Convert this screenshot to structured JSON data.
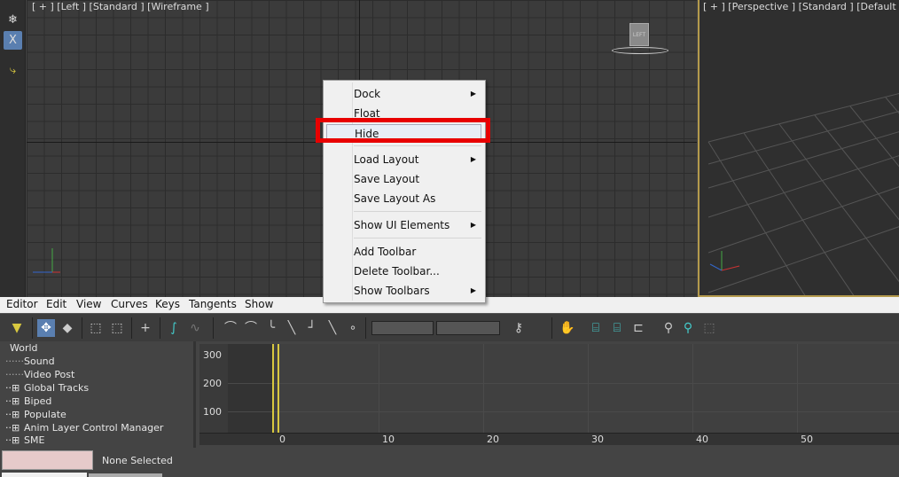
{
  "viewports": {
    "left_label": "[ + ] [Left ] [Standard ] [Wireframe ]",
    "right_label": "[ + ] [Perspective ] [Standard ] [Default Shadi",
    "viewcube_label": "LEFT"
  },
  "menubar": [
    "Editor",
    "Edit",
    "View",
    "Curves",
    "Keys",
    "Tangents",
    "Show"
  ],
  "context_menu": [
    {
      "label": "Dock",
      "submenu": true
    },
    {
      "label": "Float",
      "submenu": false
    },
    {
      "label": "Hide",
      "submenu": false,
      "highlighted": true
    },
    {
      "label": "Load Layout",
      "submenu": true
    },
    {
      "label": "Save Layout",
      "submenu": false
    },
    {
      "label": "Save Layout As",
      "submenu": false
    },
    {
      "label": "Show UI Elements",
      "submenu": true
    },
    {
      "label": "Add Toolbar",
      "submenu": false
    },
    {
      "label": "Delete Toolbar...",
      "submenu": false
    },
    {
      "label": "Show Toolbars",
      "submenu": true
    }
  ],
  "tree": [
    "World",
    "Sound",
    "Video Post",
    "Global Tracks",
    "Biped",
    "Populate",
    "Anim Layer Control Manager",
    "SME"
  ],
  "graph": {
    "y_labels": [
      "300",
      "200",
      "100"
    ],
    "x_labels": [
      "0",
      "10",
      "20",
      "30",
      "40",
      "50"
    ]
  },
  "status": {
    "selection": "None Selected"
  },
  "colors": {
    "highlight_box": "#e80000",
    "active_viewport_border": "#b49a4c",
    "key_line": "#d8c840"
  }
}
